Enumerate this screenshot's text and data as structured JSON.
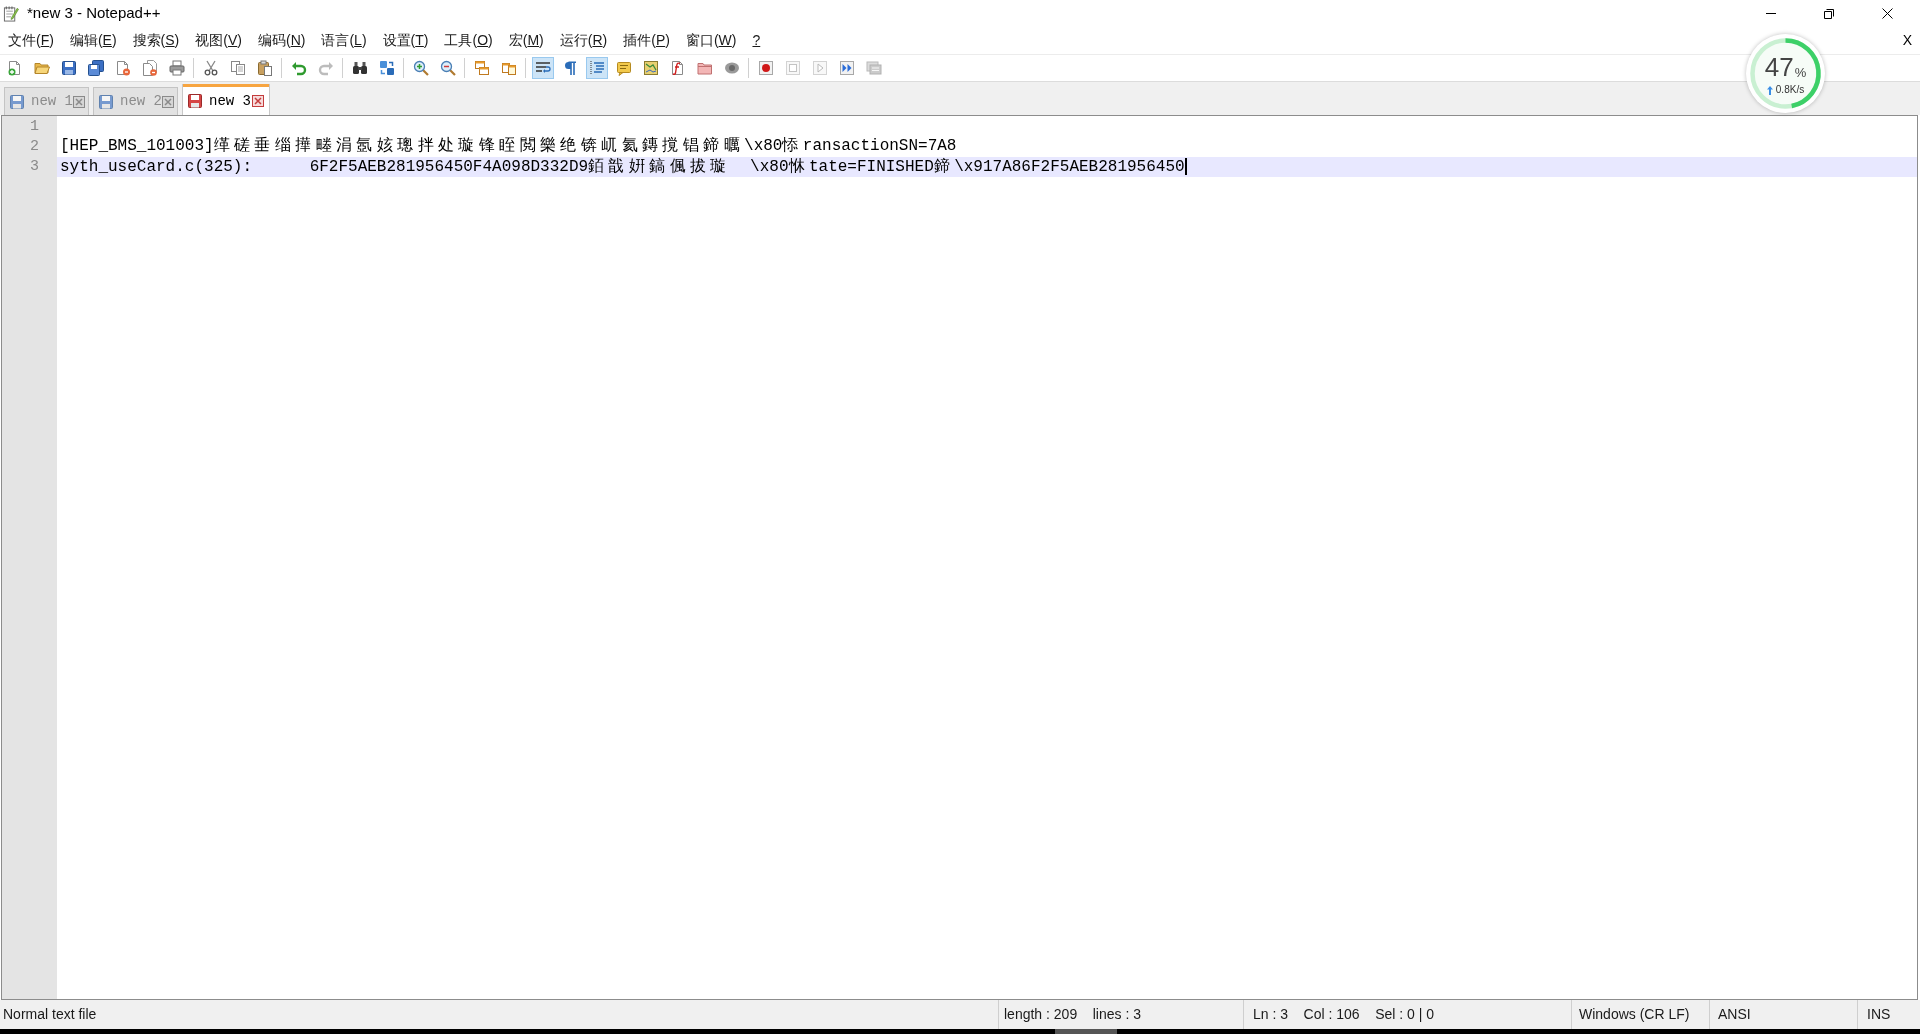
{
  "window": {
    "title": "*new 3 - Notepad++"
  },
  "menu": {
    "items": [
      "文件(F)",
      "编辑(E)",
      "搜索(S)",
      "视图(V)",
      "编码(N)",
      "语言(L)",
      "设置(T)",
      "工具(O)",
      "宏(M)",
      "运行(R)",
      "插件(P)",
      "窗口(W)",
      "?"
    ],
    "close_label": "X"
  },
  "toolbar": {
    "groups": [
      [
        {
          "checked": false,
          "disabled": false
        },
        {
          "checked": false,
          "disabled": false
        },
        {
          "checked": false,
          "disabled": false
        },
        {
          "checked": false,
          "disabled": false
        },
        {
          "checked": false,
          "disabled": false
        },
        {
          "checked": false,
          "disabled": false
        },
        {
          "checked": false,
          "disabled": false
        }
      ],
      [
        {
          "checked": false,
          "disabled": false
        },
        {
          "checked": false,
          "disabled": false
        },
        {
          "checked": false,
          "disabled": false
        }
      ],
      [
        {
          "checked": false,
          "disabled": false
        },
        {
          "checked": false,
          "disabled": true
        }
      ],
      [
        {
          "checked": false,
          "disabled": false
        },
        {
          "checked": false,
          "disabled": false
        }
      ],
      [
        {
          "checked": false,
          "disabled": false
        },
        {
          "checked": false,
          "disabled": false
        }
      ],
      [
        {
          "checked": false,
          "disabled": false
        },
        {
          "checked": false,
          "disabled": false
        }
      ],
      [
        {
          "checked": true,
          "disabled": false
        },
        {
          "checked": false,
          "disabled": false
        },
        {
          "checked": true,
          "disabled": false
        },
        {
          "checked": false,
          "disabled": false
        },
        {
          "checked": false,
          "disabled": false
        },
        {
          "checked": false,
          "disabled": false
        },
        {
          "checked": false,
          "disabled": false
        },
        {
          "checked": false,
          "disabled": false
        }
      ],
      [
        {
          "checked": false,
          "disabled": false
        },
        {
          "checked": false,
          "disabled": true
        },
        {
          "checked": false,
          "disabled": true
        },
        {
          "checked": false,
          "disabled": false
        },
        {
          "checked": false,
          "disabled": true
        }
      ]
    ]
  },
  "tabs": [
    {
      "label": "new 1",
      "selected": false,
      "modified": false
    },
    {
      "label": "new 2",
      "selected": false,
      "modified": false
    },
    {
      "label": "new 3",
      "selected": true,
      "modified": true
    }
  ],
  "editor": {
    "lines": [
      {
        "number": "1",
        "current": false
      },
      {
        "number": "2",
        "text": "[HEP_BMS_101003]缂磋垂缁撶畻涓氬姟璁拌处璇锋眰閲樂绝锛屼氦鏄撹锠鍗曞\\x80悿ransactionSN=7A8",
        "current": false
      },
      {
        "number": "3",
        "text": "syth_useCard.c(325):      6F2F5AEB281956450F4A098D332D9銆戠姸鎬偑拔璇  \\x80恘tate=FINISHED鍗\\x917A86F2F5AEB281956450",
        "current": true
      }
    ]
  },
  "status_bar": {
    "file_type": "Normal text file",
    "doc_stats": "length : 209    lines : 3",
    "cursor": "Ln : 3    Col : 106    Sel : 0 | 0",
    "line_ending": "Windows (CR LF)",
    "encoding": "ANSI",
    "input_mode": "INS"
  },
  "speed_widget": {
    "percent": "47",
    "unit": "%",
    "level": 0.47,
    "upload": "0.8K/s"
  }
}
